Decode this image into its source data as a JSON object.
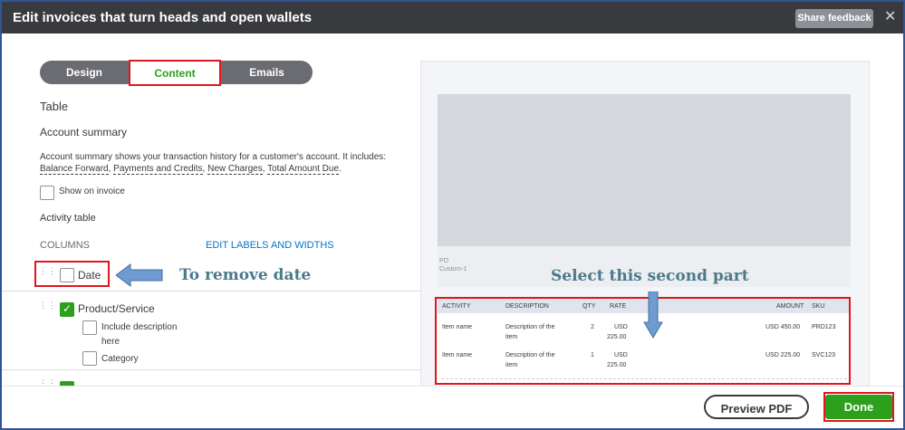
{
  "window": {
    "title": "Edit invoices that turn heads and open wallets",
    "share_label": "Share feedback",
    "close_glyph": "✕"
  },
  "tabs": [
    {
      "label": "Design"
    },
    {
      "label": "Content"
    },
    {
      "label": "Emails"
    }
  ],
  "left": {
    "section_title": "Table",
    "account_summary": "Account summary",
    "desc_line1": "Account summary shows your transaction history for a customer's account. It includes:",
    "desc_links": [
      "Balance Forward",
      "Payments and Credits",
      "New Charges",
      "Total Amount Due"
    ],
    "show_on_invoice": "Show on invoice",
    "activity_table": "Activity table",
    "columns_header": "COLUMNS",
    "edit_labels": "EDIT LABELS AND WIDTHS",
    "date_label": "Date",
    "product_service": "Product/Service",
    "include_desc_1": "Include description",
    "include_desc_2": "here",
    "category": "Category"
  },
  "annotations": {
    "remove_date": "To remove date",
    "select_second": "Select this second part"
  },
  "preview": {
    "po_label": "PO",
    "custom_label": "Custom-1",
    "headers": {
      "activity": "ACTIVITY",
      "description": "DESCRIPTION",
      "qty": "QTY",
      "rate": "RATE",
      "amount": "AMOUNT",
      "sku": "SKU"
    },
    "rows": [
      {
        "activity": "Item name",
        "desc1": "Description of the",
        "desc2": "item",
        "qty": "2",
        "rate1": "USD",
        "rate2": "225.00",
        "amount": "USD 450.00",
        "sku": "PRD123"
      },
      {
        "activity": "Item name",
        "desc1": "Description of the",
        "desc2": "item",
        "qty": "1",
        "rate1": "USD",
        "rate2": "225.00",
        "amount": "USD 225.00",
        "sku": "SVC123"
      }
    ]
  },
  "footer": {
    "preview_pdf": "Preview PDF",
    "done": "Done"
  },
  "colors": {
    "accent_green": "#2ca01c",
    "annotation_red": "#e0161c",
    "title_bar": "#393a3d",
    "link_blue": "#0077c5"
  }
}
